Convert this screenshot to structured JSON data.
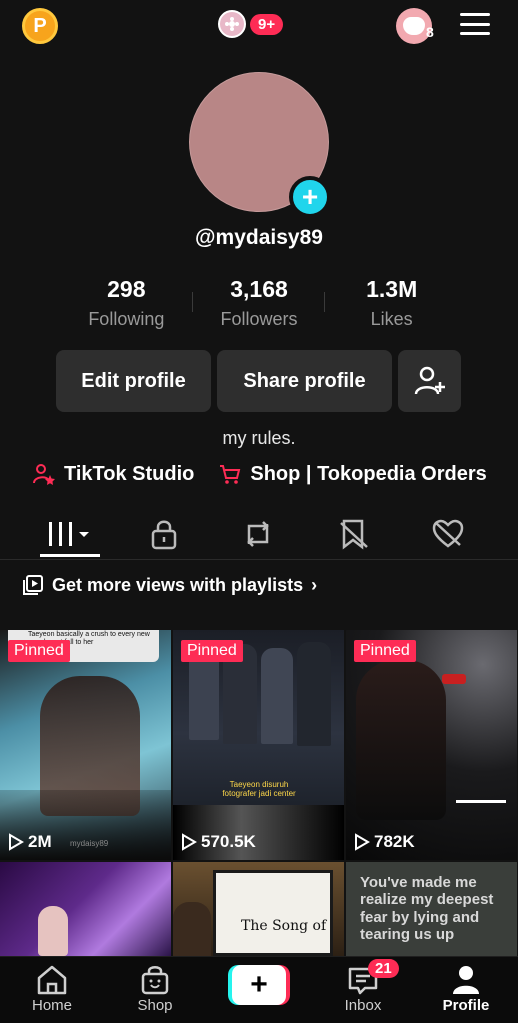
{
  "topbar": {
    "coin_label": "P",
    "notification_count": "9+",
    "friends_count": "8"
  },
  "profile": {
    "username": "@mydaisy89",
    "bio": "my rules.",
    "stats": [
      {
        "value": "298",
        "label": "Following"
      },
      {
        "value": "3,168",
        "label": "Followers"
      },
      {
        "value": "1.3M",
        "label": "Likes"
      }
    ],
    "buttons": {
      "edit": "Edit profile",
      "share": "Share profile"
    },
    "links": {
      "studio": "TikTok Studio",
      "shop": "Shop | Tokopedia Orders"
    }
  },
  "tabs": [
    {
      "icon": "grid-icon",
      "active": true
    },
    {
      "icon": "lock-icon",
      "active": false
    },
    {
      "icon": "repost-icon",
      "active": false
    },
    {
      "icon": "bookmark-icon",
      "active": false
    },
    {
      "icon": "liked-icon",
      "active": false
    }
  ],
  "playlist_prompt": "Get more views with playlists",
  "videos": [
    {
      "pinned_label": "Pinned",
      "views": "2M",
      "caption_top": "Taeyeon basically a crush to every new gen doesnt fall to her",
      "watermark": "mydaisy89"
    },
    {
      "pinned_label": "Pinned",
      "views": "570.5K",
      "caption": "Taeyeon disuruh fotografer jadi center"
    },
    {
      "pinned_label": "Pinned",
      "views": "782K"
    },
    {
      "views": ""
    },
    {
      "views": "",
      "caption": "The Song of"
    },
    {
      "overlay_text": "You've made me realize my deepest fear by lying and tearing us up"
    }
  ],
  "bottom_nav": {
    "home": "Home",
    "shop": "Shop",
    "inbox": "Inbox",
    "inbox_badge": "21",
    "profile": "Profile"
  },
  "colors": {
    "background": "#121212",
    "accent_red": "#fe2c55",
    "accent_cyan": "#20d5ec",
    "button_bg": "#2e2e2e"
  }
}
